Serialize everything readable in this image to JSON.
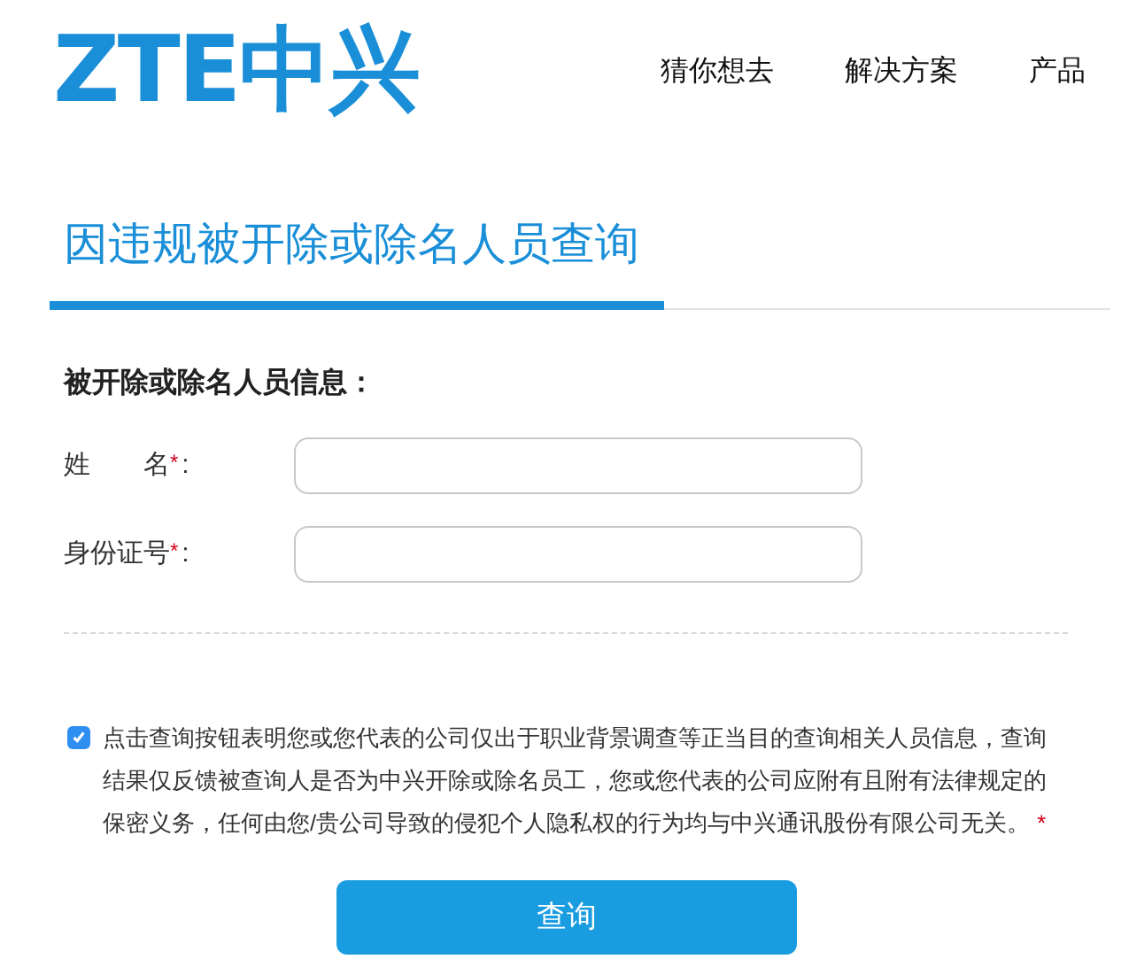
{
  "header": {
    "logo": "ZTE中兴",
    "nav": [
      "猜你想去",
      "解决方案",
      "产品"
    ]
  },
  "page_title": "因违规被开除或除名人员查询",
  "section_heading": "被开除或除名人员信息：",
  "fields": [
    {
      "label": "姓　　名",
      "required_mark": "*",
      "suffix": ":"
    },
    {
      "label": "身份证号",
      "required_mark": "*",
      "suffix": ":"
    }
  ],
  "consent": {
    "checked": true,
    "text": "点击查询按钮表明您或您代表的公司仅出于职业背景调查等正当目的查询相关人员信息，查询结果仅反馈被查询人是否为中兴开除或除名员工，您或您代表的公司应附有且附有法律规定的保密义务，任何由您/贵公司导致的侵犯个人隐私权的行为均与中兴通讯股份有限公司无关。",
    "required_mark": "*"
  },
  "submit_button": "查询"
}
